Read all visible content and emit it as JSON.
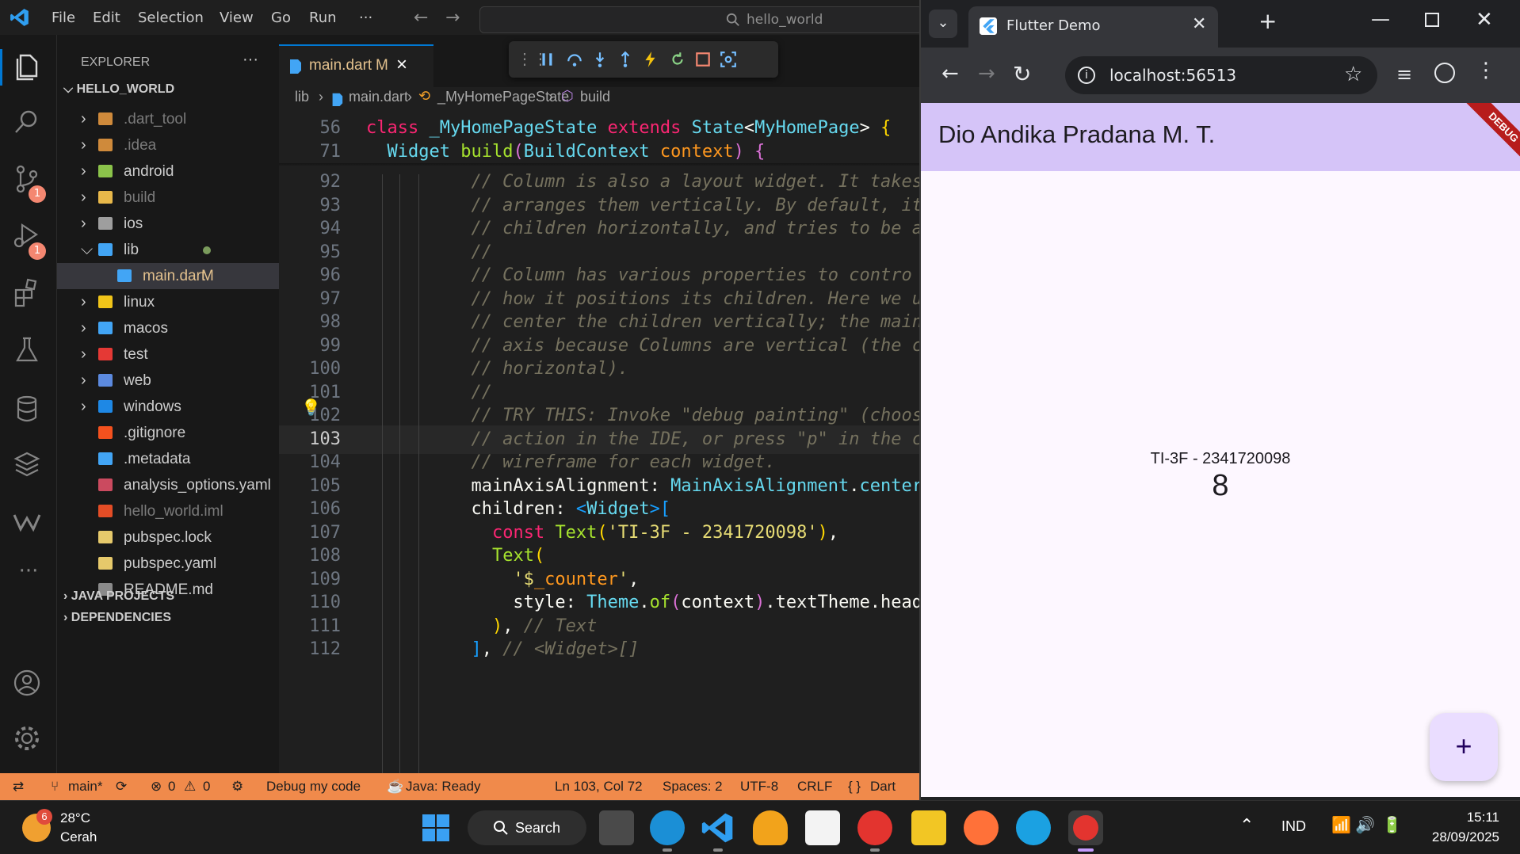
{
  "vscode": {
    "menu": [
      "File",
      "Edit",
      "Selection",
      "View",
      "Go",
      "Run",
      "···"
    ],
    "search_text": "hello_world",
    "activity_badges": {
      "source_control": "1",
      "run_debug": "1"
    },
    "explorer": {
      "title": "EXPLORER",
      "more": "···",
      "root": "HELLO_WORLD",
      "items": [
        {
          "label": ".dart_tool",
          "type": "folder",
          "color": "#cf8a3b",
          "dim": true
        },
        {
          "label": ".idea",
          "type": "folder",
          "color": "#cf8a3b",
          "dim": true
        },
        {
          "label": "android",
          "type": "folder",
          "color": "#8bc34a",
          "dim": false
        },
        {
          "label": "build",
          "type": "folder",
          "color": "#e8b84a",
          "dim": true
        },
        {
          "label": "ios",
          "type": "folder",
          "color": "#9e9e9e",
          "dim": false
        },
        {
          "label": "lib",
          "type": "folder-open",
          "color": "#42a5f5",
          "dim": false
        },
        {
          "label": "main.dart",
          "type": "file",
          "color": "#42a5f5",
          "dim": false
        },
        {
          "label": "linux",
          "type": "folder",
          "color": "#f0c419",
          "dim": false
        },
        {
          "label": "macos",
          "type": "folder",
          "color": "#42a5f5",
          "dim": false
        },
        {
          "label": "test",
          "type": "folder",
          "color": "#e53935",
          "dim": false
        },
        {
          "label": "web",
          "type": "folder",
          "color": "#5c8adf",
          "dim": false
        },
        {
          "label": "windows",
          "type": "folder",
          "color": "#1e88e5",
          "dim": false
        },
        {
          "label": ".gitignore",
          "type": "file",
          "color": "#f4511e",
          "dim": false
        },
        {
          "label": ".metadata",
          "type": "file",
          "color": "#42a5f5",
          "dim": false
        },
        {
          "label": "analysis_options.yaml",
          "type": "file",
          "color": "#cb4a5f",
          "dim": false
        },
        {
          "label": "hello_world.iml",
          "type": "file",
          "color": "#e44d26",
          "dim": true
        },
        {
          "label": "pubspec.lock",
          "type": "file",
          "color": "#e6c96b",
          "dim": false
        },
        {
          "label": "pubspec.yaml",
          "type": "file",
          "color": "#e6c96b",
          "dim": false
        },
        {
          "label": "README.md",
          "type": "file",
          "color": "#8a8a8a",
          "dim": false
        }
      ],
      "modified_marker": "M",
      "sections": [
        "JAVA PROJECTS",
        "DEPENDENCIES"
      ]
    },
    "tab": {
      "label": "main.dart",
      "status": "M",
      "close": "×"
    },
    "breadcrumb": [
      "lib",
      "main.dart",
      "_MyHomePageState",
      "build"
    ],
    "sticky": [
      {
        "ln": "56",
        "tokens": [
          [
            "kw",
            "class "
          ],
          [
            "cls",
            "_MyHomePageState "
          ],
          [
            "kw",
            "extends "
          ],
          [
            "cls",
            "State"
          ],
          [
            "id",
            "<"
          ],
          [
            "cls",
            "MyHomePage"
          ],
          [
            "id",
            "> "
          ],
          [
            "p1",
            "{"
          ]
        ]
      },
      {
        "ln": "71",
        "tokens": [
          [
            "id",
            "  "
          ],
          [
            "cls",
            "Widget "
          ],
          [
            "fn",
            "build"
          ],
          [
            "p2",
            "("
          ],
          [
            "cls",
            "BuildContext "
          ],
          [
            "prm",
            "context"
          ],
          [
            "p2",
            ")"
          ],
          [
            "id",
            " "
          ],
          [
            "p2",
            "{"
          ]
        ]
      }
    ],
    "lines": [
      {
        "ln": "92",
        "tokens": [
          [
            "cmt",
            "          // Column is also a layout widget. It takes"
          ]
        ]
      },
      {
        "ln": "93",
        "tokens": [
          [
            "cmt",
            "          // arranges them vertically. By default, it"
          ]
        ]
      },
      {
        "ln": "94",
        "tokens": [
          [
            "cmt",
            "          // children horizontally, and tries to be a"
          ]
        ]
      },
      {
        "ln": "95",
        "tokens": [
          [
            "cmt",
            "          //"
          ]
        ]
      },
      {
        "ln": "96",
        "tokens": [
          [
            "cmt",
            "          // Column has various properties to contro"
          ]
        ]
      },
      {
        "ln": "97",
        "tokens": [
          [
            "cmt",
            "          // how it positions its children. Here we u"
          ]
        ]
      },
      {
        "ln": "98",
        "tokens": [
          [
            "cmt",
            "          // center the children vertically; the main"
          ]
        ]
      },
      {
        "ln": "99",
        "tokens": [
          [
            "cmt",
            "          // axis because Columns are vertical (the c"
          ]
        ]
      },
      {
        "ln": "100",
        "tokens": [
          [
            "cmt",
            "          // horizontal)."
          ]
        ]
      },
      {
        "ln": "101",
        "tokens": [
          [
            "cmt",
            "          //"
          ]
        ]
      },
      {
        "ln": "102",
        "tokens": [
          [
            "cmt",
            "          // TRY THIS: Invoke \"debug painting\" (choos"
          ]
        ]
      },
      {
        "ln": "103",
        "tokens": [
          [
            "cmt",
            "          // action in the IDE, or press \"p\" in the c"
          ]
        ]
      },
      {
        "ln": "104",
        "tokens": [
          [
            "cmt",
            "          // wireframe for each widget."
          ]
        ]
      },
      {
        "ln": "105",
        "tokens": [
          [
            "id",
            "          mainAxisAlignment: "
          ],
          [
            "cls",
            "MainAxisAlignment"
          ],
          [
            "id",
            "."
          ],
          [
            "cls",
            "center"
          ]
        ]
      },
      {
        "ln": "106",
        "tokens": [
          [
            "id",
            "          children: "
          ],
          [
            "p3",
            "<"
          ],
          [
            "cls",
            "Widget"
          ],
          [
            "p3",
            ">["
          ]
        ]
      },
      {
        "ln": "107",
        "tokens": [
          [
            "id",
            "            "
          ],
          [
            "kw",
            "const "
          ],
          [
            "fn",
            "Text"
          ],
          [
            "p1",
            "("
          ],
          [
            "str",
            "'TI-3F - 2341720098'"
          ],
          [
            "p1",
            ")"
          ],
          [
            "id",
            ","
          ]
        ]
      },
      {
        "ln": "108",
        "tokens": [
          [
            "id",
            "            "
          ],
          [
            "fn",
            "Text"
          ],
          [
            "p1",
            "("
          ]
        ]
      },
      {
        "ln": "109",
        "tokens": [
          [
            "id",
            "              "
          ],
          [
            "str",
            "'$"
          ],
          [
            "prm",
            "_counter"
          ],
          [
            "str",
            "'"
          ],
          [
            "id",
            ","
          ]
        ]
      },
      {
        "ln": "110",
        "tokens": [
          [
            "id",
            "              style: "
          ],
          [
            "cls",
            "Theme"
          ],
          [
            "id",
            "."
          ],
          [
            "fn",
            "of"
          ],
          [
            "p2",
            "("
          ],
          [
            "id",
            "context"
          ],
          [
            "p2",
            ")"
          ],
          [
            "id",
            ".textTheme.head"
          ]
        ]
      },
      {
        "ln": "111",
        "tokens": [
          [
            "id",
            "            "
          ],
          [
            "p1",
            ")"
          ],
          [
            "id",
            ", "
          ],
          [
            "cmt",
            "// Text"
          ]
        ]
      },
      {
        "ln": "112",
        "tokens": [
          [
            "id",
            "          "
          ],
          [
            "p3",
            "]"
          ],
          [
            "id",
            ", "
          ],
          [
            "cmt",
            "// <Widget>[]"
          ]
        ]
      }
    ],
    "status": {
      "branch": "main*",
      "errors": "0",
      "warnings": "0",
      "debug": "Debug my code",
      "java": "Java: Ready",
      "position": "Ln 103, Col 72",
      "spaces": "Spaces: 2",
      "encoding": "UTF-8",
      "eol": "CRLF",
      "language": "Dart"
    }
  },
  "browser": {
    "tab_title": "Flutter Demo",
    "url": "localhost:56513",
    "app_title": "Dio Andika Pradana M. T.",
    "debug_banner": "DEBUG",
    "label": "TI-3F - 2341720098",
    "counter": "8",
    "fab": "+"
  },
  "taskbar": {
    "weather_badge": "6",
    "temp": "28°C",
    "condition": "Cerah",
    "search": "Search",
    "lang": "IND",
    "time": "15:11",
    "date": "28/09/2025"
  },
  "colors": {
    "accent": "#0078d4",
    "status_bg": "#f08a4b",
    "app_bar": "#d5c4f8",
    "fab": "#eaddff"
  }
}
